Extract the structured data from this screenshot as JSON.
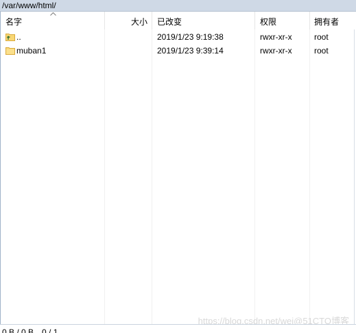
{
  "path": "/var/www/html/",
  "columns": {
    "name": "名字",
    "size": "大小",
    "modified": "已改变",
    "permissions": "权限",
    "owner": "拥有者"
  },
  "rows": [
    {
      "name": "..",
      "size": "",
      "modified": "2019/1/23 9:19:38",
      "permissions": "rwxr-xr-x",
      "owner": "root",
      "icon": "parent-folder-icon"
    },
    {
      "name": "muban1",
      "size": "",
      "modified": "2019/1/23 9:39:14",
      "permissions": "rwxr-xr-x",
      "owner": "root",
      "icon": "folder-icon"
    }
  ],
  "status": "0 B / 0 B，0 / 1",
  "watermark": "https://blog.csdn.net/wei@51CTO博客",
  "colors": {
    "pathbar_bg": "#cfd9e6",
    "folder_yellow": "#f8d775",
    "arrow_green": "#2e8b2e"
  }
}
